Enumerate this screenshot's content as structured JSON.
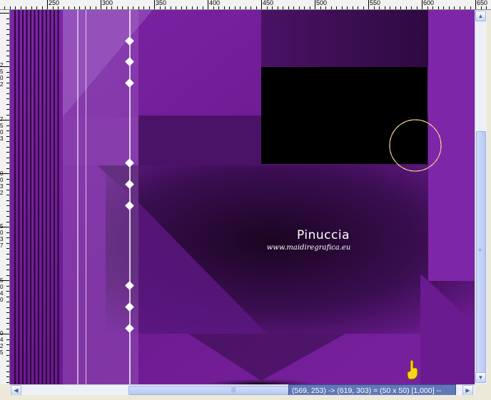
{
  "ruler": {
    "top_labels": [
      "250",
      "300",
      "350",
      "400",
      "450",
      "500",
      "550",
      "600",
      "650"
    ],
    "left_labels": [
      "2",
      "5",
      "0",
      "2",
      "7",
      "5",
      "0",
      "3",
      "0",
      "0",
      "3",
      "2",
      "5",
      "0",
      "3",
      "7",
      "5",
      "0",
      "4",
      "0",
      "0",
      "4",
      "2",
      "5"
    ]
  },
  "canvas": {
    "watermark_title": "Pinuccia",
    "watermark_url": "www.maidiregrafica.eu",
    "colors": {
      "purple": "#7a22a0",
      "dark_purple": "#2a0a3a",
      "black": "#000000",
      "light_purple": "#9b5bbd"
    }
  },
  "status": {
    "selection_text": "(569, 253) -> (619, 303) = (50 x 50) [1,000] --"
  },
  "icons": {
    "cursor": "pointing-hand-icon",
    "selection": "brush-circle-icon"
  }
}
